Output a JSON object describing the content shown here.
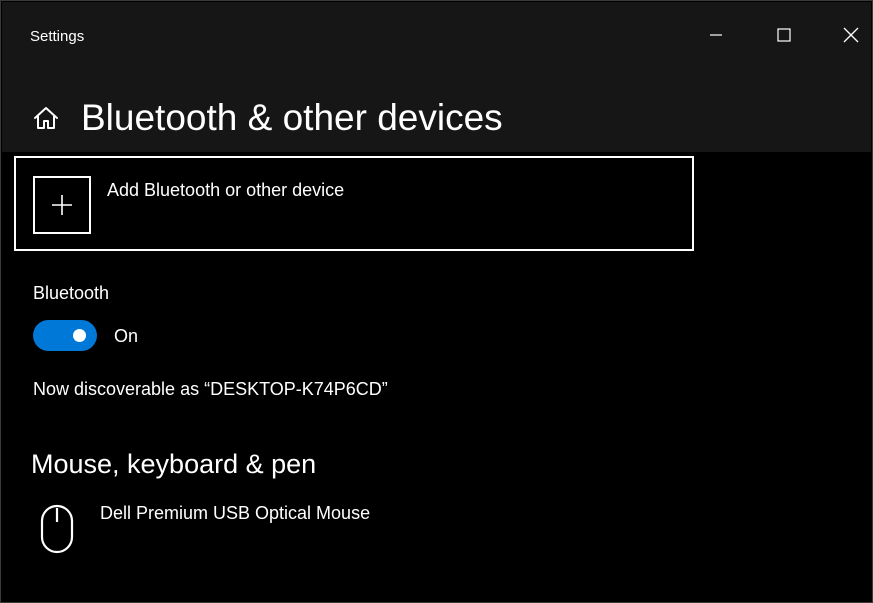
{
  "window": {
    "title": "Settings",
    "controls": {
      "minimize_icon": "minimize-icon",
      "maximize_icon": "maximize-icon",
      "close_icon": "close-icon"
    }
  },
  "header": {
    "home_icon": "home-icon",
    "title": "Bluetooth & other devices"
  },
  "add_device": {
    "icon": "plus-icon",
    "label": "Add Bluetooth or other device"
  },
  "bluetooth": {
    "label": "Bluetooth",
    "toggle_on": true,
    "state_text": "On",
    "discoverable_text": "Now discoverable as “DESKTOP-K74P6CD”"
  },
  "mouse_keyboard_pen": {
    "heading": "Mouse, keyboard & pen",
    "devices": [
      {
        "icon": "mouse-icon",
        "name": "Dell Premium USB Optical Mouse"
      }
    ]
  },
  "colors": {
    "background": "#000000",
    "header_band": "#161616",
    "accent": "#0078d7",
    "text": "#ffffff"
  }
}
